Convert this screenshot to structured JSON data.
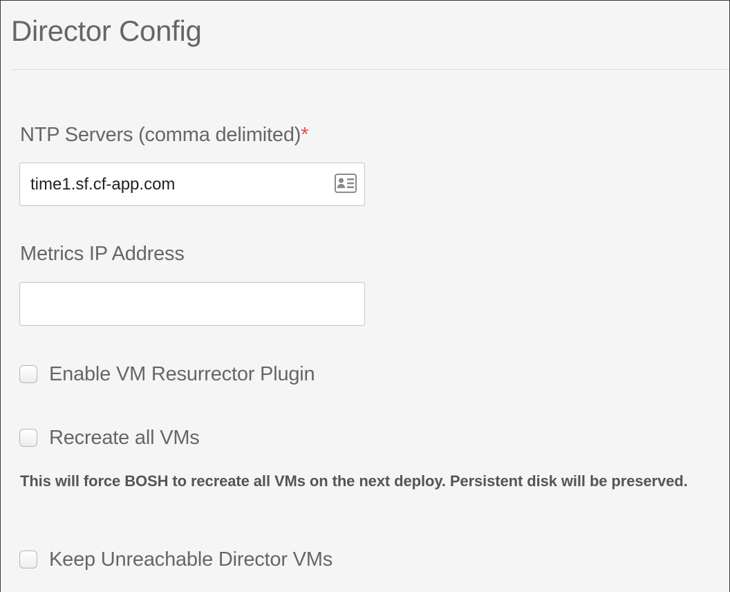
{
  "page": {
    "title": "Director Config"
  },
  "fields": {
    "ntp_servers": {
      "label": "NTP Servers (comma delimited)",
      "required_mark": "*",
      "value": "time1.sf.cf-app.com",
      "icon": "contact-card-icon"
    },
    "metrics_ip": {
      "label": "Metrics IP Address",
      "value": ""
    }
  },
  "checkboxes": {
    "resurrector": {
      "label": "Enable VM Resurrector Plugin",
      "checked": false
    },
    "recreate_vms": {
      "label": "Recreate all VMs",
      "checked": false,
      "help": "This will force BOSH to recreate all VMs on the next deploy. Persistent disk will be preserved."
    },
    "keep_unreachable": {
      "label": "Keep Unreachable Director VMs",
      "checked": false
    }
  },
  "colors": {
    "required": "#d9534f",
    "background": "#f5f5f5"
  }
}
